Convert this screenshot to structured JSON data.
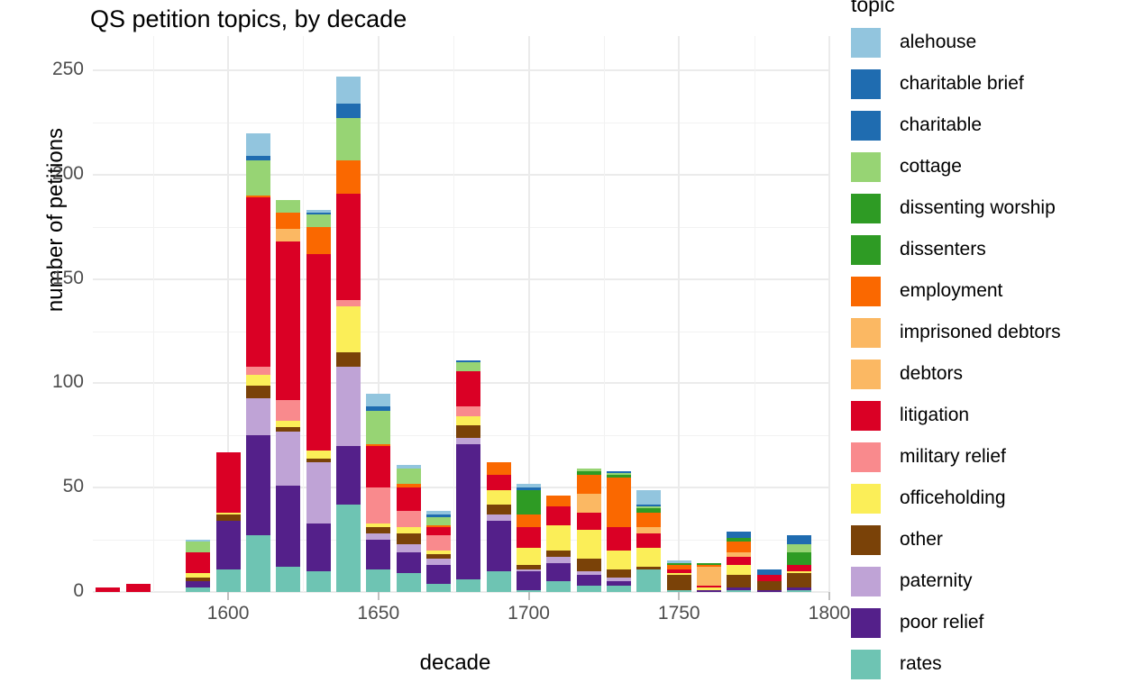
{
  "title": "QS petition topics, by decade",
  "axes": {
    "x_label": "decade",
    "y_label": "number of petitions",
    "x_ticks": [
      "1600",
      "1650",
      "1700",
      "1750",
      "1800"
    ],
    "y_ticks": [
      "0",
      "50",
      "100",
      "150",
      "200",
      "250"
    ]
  },
  "legend": {
    "title": "topic",
    "items": [
      {
        "label": "alehouse",
        "color": "#92C5DE"
      },
      {
        "label": "charitable brief",
        "color": "#1F6CB0"
      },
      {
        "label": "charitable",
        "color": "#1F6CB0"
      },
      {
        "label": "cottage",
        "color": "#97D474"
      },
      {
        "label": "dissenting worship",
        "color": "#2E9B24"
      },
      {
        "label": "dissenters",
        "color": "#2E9B24"
      },
      {
        "label": "employment",
        "color": "#FA6800"
      },
      {
        "label": "imprisoned debtors",
        "color": "#FBB863"
      },
      {
        "label": "debtors",
        "color": "#FBB863"
      },
      {
        "label": "litigation",
        "color": "#DA0025"
      },
      {
        "label": "military relief",
        "color": "#F98A8D"
      },
      {
        "label": "officeholding",
        "color": "#FBEE58"
      },
      {
        "label": "other",
        "color": "#7A4208"
      },
      {
        "label": "paternity",
        "color": "#BFA3D6"
      },
      {
        "label": "poor relief",
        "color": "#54208A"
      },
      {
        "label": "rates",
        "color": "#6EC4B3"
      }
    ]
  },
  "chart_data": {
    "type": "bar",
    "title": "QS petition topics, by decade",
    "xlabel": "decade",
    "ylabel": "number of petitions",
    "stacked": true,
    "grid": true,
    "legend_position": "right",
    "xlim": [
      1555,
      1800
    ],
    "ylim": [
      0,
      253
    ],
    "categories": [
      1560,
      1570,
      1580,
      1590,
      1600,
      1610,
      1620,
      1630,
      1640,
      1650,
      1660,
      1670,
      1680,
      1690,
      1700,
      1710,
      1720,
      1730,
      1740,
      1750,
      1760,
      1770,
      1780,
      1790
    ],
    "stack_order_bottom_to_top": [
      "rates",
      "poor relief",
      "paternity",
      "other",
      "officeholding",
      "military relief",
      "litigation",
      "debtors",
      "imprisoned debtors",
      "employment",
      "dissenters",
      "dissenting worship",
      "cottage",
      "charitable",
      "charitable brief",
      "alehouse"
    ],
    "series": [
      {
        "name": "rates",
        "color": "#6EC4B3",
        "values": [
          0,
          0,
          0,
          2,
          11,
          27,
          12,
          10,
          42,
          11,
          9,
          4,
          6,
          10,
          1,
          5,
          3,
          3,
          11,
          1,
          0,
          1,
          0,
          1
        ]
      },
      {
        "name": "poor relief",
        "color": "#54208A",
        "values": [
          0,
          0,
          0,
          3,
          23,
          48,
          39,
          23,
          28,
          14,
          10,
          9,
          65,
          24,
          9,
          9,
          5,
          2,
          0,
          0,
          1,
          1,
          1,
          1
        ]
      },
      {
        "name": "paternity",
        "color": "#BFA3D6",
        "values": [
          0,
          0,
          0,
          0,
          0,
          18,
          26,
          29,
          38,
          3,
          4,
          3,
          3,
          3,
          1,
          3,
          2,
          2,
          0,
          0,
          0,
          0,
          0,
          0
        ]
      },
      {
        "name": "other",
        "color": "#7A4208",
        "values": [
          0,
          0,
          0,
          2,
          3,
          6,
          2,
          2,
          7,
          3,
          5,
          2,
          6,
          5,
          2,
          3,
          6,
          4,
          1,
          7,
          0,
          6,
          4,
          7
        ]
      },
      {
        "name": "officeholding",
        "color": "#FBEE58",
        "values": [
          0,
          0,
          0,
          2,
          1,
          5,
          3,
          4,
          22,
          2,
          3,
          2,
          4,
          7,
          8,
          12,
          14,
          9,
          9,
          1,
          1,
          5,
          0,
          1
        ]
      },
      {
        "name": "military relief",
        "color": "#F98A8D",
        "values": [
          0,
          0,
          0,
          0,
          0,
          4,
          10,
          0,
          3,
          17,
          8,
          7,
          5,
          0,
          0,
          0,
          0,
          0,
          0,
          0,
          0,
          0,
          0,
          0
        ]
      },
      {
        "name": "litigation",
        "color": "#DA0025",
        "values": [
          2,
          4,
          0,
          10,
          29,
          81,
          76,
          94,
          51,
          20,
          11,
          4,
          17,
          7,
          10,
          9,
          8,
          11,
          7,
          2,
          1,
          4,
          3,
          3
        ]
      },
      {
        "name": "debtors",
        "color": "#FBB863",
        "values": [
          0,
          0,
          0,
          0,
          0,
          0,
          6,
          0,
          0,
          0,
          0,
          0,
          0,
          0,
          0,
          0,
          9,
          0,
          3,
          0,
          9,
          2,
          0,
          0
        ]
      },
      {
        "name": "imprisoned debtors",
        "color": "#FBB863",
        "values": [
          0,
          0,
          0,
          0,
          0,
          0,
          0,
          0,
          0,
          0,
          0,
          0,
          0,
          0,
          0,
          0,
          0,
          0,
          0,
          0,
          0,
          0,
          0,
          0
        ]
      },
      {
        "name": "employment",
        "color": "#FA6800",
        "values": [
          0,
          0,
          0,
          0,
          0,
          1,
          8,
          13,
          16,
          1,
          2,
          1,
          0,
          6,
          6,
          5,
          9,
          24,
          7,
          2,
          1,
          5,
          0,
          0
        ]
      },
      {
        "name": "dissenters",
        "color": "#2E9B24",
        "values": [
          0,
          0,
          0,
          0,
          0,
          0,
          0,
          0,
          0,
          0,
          0,
          0,
          0,
          0,
          12,
          0,
          2,
          1,
          2,
          1,
          1,
          2,
          0,
          6
        ]
      },
      {
        "name": "dissenting worship",
        "color": "#2E9B24",
        "values": [
          0,
          0,
          0,
          0,
          0,
          0,
          0,
          0,
          0,
          0,
          0,
          0,
          0,
          0,
          0,
          0,
          0,
          0,
          0,
          0,
          0,
          0,
          0,
          0
        ]
      },
      {
        "name": "cottage",
        "color": "#97D474",
        "values": [
          0,
          0,
          0,
          5,
          0,
          17,
          6,
          6,
          20,
          16,
          7,
          4,
          4,
          0,
          0,
          0,
          1,
          1,
          1,
          0,
          0,
          0,
          0,
          4
        ]
      },
      {
        "name": "charitable",
        "color": "#1F6CB0",
        "values": [
          0,
          0,
          0,
          0,
          0,
          2,
          0,
          1,
          7,
          2,
          0,
          1,
          1,
          0,
          1,
          0,
          0,
          1,
          1,
          0,
          0,
          3,
          3,
          4
        ]
      },
      {
        "name": "charitable brief",
        "color": "#1F6CB0",
        "values": [
          0,
          0,
          0,
          0,
          0,
          0,
          0,
          0,
          0,
          0,
          0,
          0,
          0,
          0,
          0,
          0,
          0,
          0,
          0,
          0,
          0,
          0,
          0,
          0
        ]
      },
      {
        "name": "alehouse",
        "color": "#92C5DE",
        "values": [
          0,
          0,
          0,
          1,
          0,
          11,
          0,
          1,
          13,
          6,
          2,
          2,
          0,
          0,
          2,
          0,
          0,
          0,
          7,
          1,
          0,
          0,
          0,
          0
        ]
      }
    ],
    "totals": [
      2,
      4,
      0,
      25,
      67,
      220,
      188,
      183,
      247,
      95,
      61,
      39,
      111,
      62,
      52,
      46,
      59,
      58,
      49,
      15,
      14,
      29,
      11,
      27
    ]
  }
}
